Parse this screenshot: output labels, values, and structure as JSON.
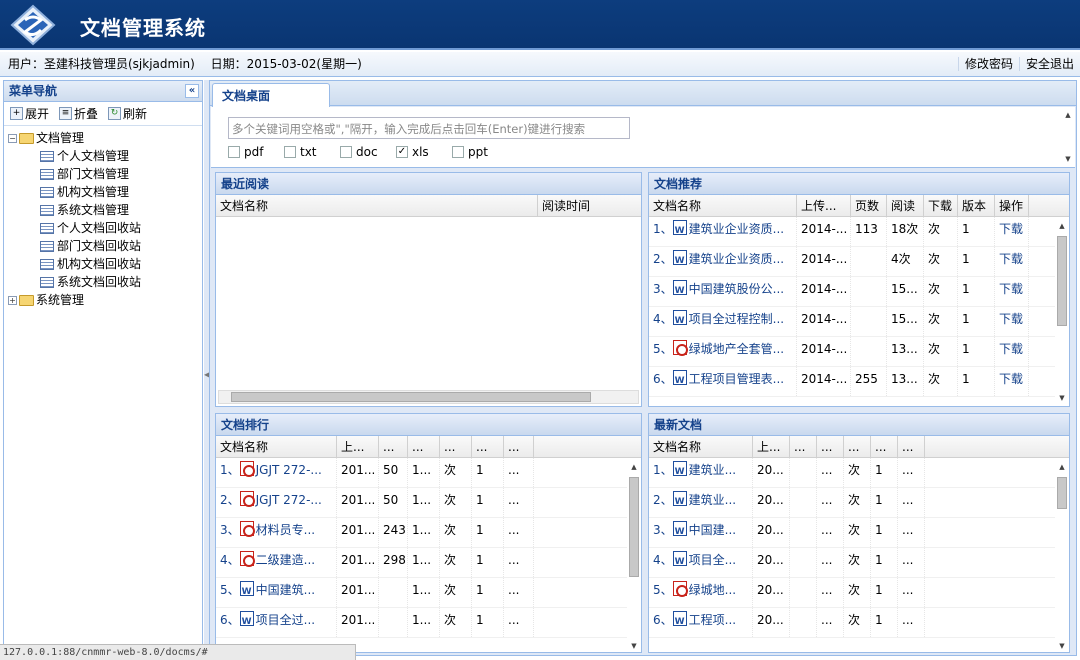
{
  "app": {
    "title": "文档管理系统"
  },
  "userbar": {
    "user_label": "用户：圣建科技管理员(sjkjadmin)",
    "date_label": "日期：2015-03-02(星期一)",
    "change_password": "修改密码",
    "logout": "安全退出"
  },
  "sidebar": {
    "title": "菜单导航",
    "expand": "展开",
    "fold": "折叠",
    "refresh": "刷新",
    "tree": [
      {
        "label": "文档管理",
        "expanded": true,
        "children": [
          "个人文档管理",
          "部门文档管理",
          "机构文档管理",
          "系统文档管理",
          "个人文档回收站",
          "部门文档回收站",
          "机构文档回收站",
          "系统文档回收站"
        ]
      },
      {
        "label": "系统管理",
        "expanded": false,
        "children": []
      }
    ]
  },
  "tabs": [
    {
      "label": "文档桌面",
      "active": true
    }
  ],
  "search": {
    "placeholder": "多个关键词用空格或\",\"隔开，输入完成后点击回车(Enter)键进行搜索",
    "types": [
      {
        "label": "pdf",
        "checked": false
      },
      {
        "label": "txt",
        "checked": false
      },
      {
        "label": "doc",
        "checked": false
      },
      {
        "label": "xls",
        "checked": true
      },
      {
        "label": "ppt",
        "checked": false
      }
    ]
  },
  "recent": {
    "title": "最近阅读",
    "columns": [
      "文档名称",
      "阅读时间"
    ],
    "rows": []
  },
  "recommend": {
    "title": "文档推荐",
    "columns": [
      "文档名称",
      "上传...",
      "页数",
      "阅读",
      "下载",
      "版本",
      "操作"
    ],
    "rows": [
      {
        "idx": "1、",
        "icon": "word",
        "name": "建筑业企业资质...",
        "date": "2014-...",
        "pages": "113",
        "reads": "18次",
        "downloads": "次",
        "version": "1",
        "action": "下载"
      },
      {
        "idx": "2、",
        "icon": "word",
        "name": "建筑业企业资质...",
        "date": "2014-...",
        "pages": "",
        "reads": "4次",
        "downloads": "次",
        "version": "1",
        "action": "下载"
      },
      {
        "idx": "3、",
        "icon": "word",
        "name": "中国建筑股份公...",
        "date": "2014-...",
        "pages": "",
        "reads": "15...",
        "downloads": "次",
        "version": "1",
        "action": "下载"
      },
      {
        "idx": "4、",
        "icon": "word",
        "name": "项目全过程控制...",
        "date": "2014-...",
        "pages": "",
        "reads": "15...",
        "downloads": "次",
        "version": "1",
        "action": "下载"
      },
      {
        "idx": "5、",
        "icon": "pdf",
        "name": "绿城地产全套管...",
        "date": "2014-...",
        "pages": "",
        "reads": "13...",
        "downloads": "次",
        "version": "1",
        "action": "下载"
      },
      {
        "idx": "6、",
        "icon": "word",
        "name": "工程项目管理表...",
        "date": "2014-...",
        "pages": "255",
        "reads": "13...",
        "downloads": "次",
        "version": "1",
        "action": "下载"
      }
    ]
  },
  "ranking": {
    "title": "文档排行",
    "columns": [
      "文档名称",
      "上...",
      "...",
      "...",
      "...",
      "...",
      "..."
    ],
    "rows": [
      {
        "idx": "1、",
        "icon": "pdf",
        "name": "JGJT 272-...",
        "date": "201...",
        "pages": "50",
        "reads": "1...",
        "downloads": "次",
        "version": "1",
        "action": "..."
      },
      {
        "idx": "2、",
        "icon": "pdf",
        "name": "JGJT 272-...",
        "date": "201...",
        "pages": "50",
        "reads": "1...",
        "downloads": "次",
        "version": "1",
        "action": "..."
      },
      {
        "idx": "3、",
        "icon": "pdf",
        "name": "材料员专...",
        "date": "201...",
        "pages": "243",
        "reads": "1...",
        "downloads": "次",
        "version": "1",
        "action": "..."
      },
      {
        "idx": "4、",
        "icon": "pdf",
        "name": "二级建造...",
        "date": "201...",
        "pages": "298",
        "reads": "1...",
        "downloads": "次",
        "version": "1",
        "action": "..."
      },
      {
        "idx": "5、",
        "icon": "word",
        "name": "中国建筑...",
        "date": "201...",
        "pages": "",
        "reads": "1...",
        "downloads": "次",
        "version": "1",
        "action": "..."
      },
      {
        "idx": "6、",
        "icon": "word",
        "name": "项目全过...",
        "date": "201...",
        "pages": "",
        "reads": "1...",
        "downloads": "次",
        "version": "1",
        "action": "..."
      }
    ]
  },
  "latest": {
    "title": "最新文档",
    "columns": [
      "文档名称",
      "上...",
      "...",
      "...",
      "...",
      "...",
      "..."
    ],
    "rows": [
      {
        "idx": "1、",
        "icon": "word",
        "name": "建筑业...",
        "date": "20...",
        "pages": "",
        "reads": "...",
        "downloads": "次",
        "version": "1",
        "action": "..."
      },
      {
        "idx": "2、",
        "icon": "word",
        "name": "建筑业...",
        "date": "20...",
        "pages": "",
        "reads": "...",
        "downloads": "次",
        "version": "1",
        "action": "..."
      },
      {
        "idx": "3、",
        "icon": "word",
        "name": "中国建...",
        "date": "20...",
        "pages": "",
        "reads": "...",
        "downloads": "次",
        "version": "1",
        "action": "..."
      },
      {
        "idx": "4、",
        "icon": "word",
        "name": "项目全...",
        "date": "20...",
        "pages": "",
        "reads": "...",
        "downloads": "次",
        "version": "1",
        "action": "..."
      },
      {
        "idx": "5、",
        "icon": "pdf",
        "name": "绿城地...",
        "date": "20...",
        "pages": "",
        "reads": "...",
        "downloads": "次",
        "version": "1",
        "action": "..."
      },
      {
        "idx": "6、",
        "icon": "word",
        "name": "工程项...",
        "date": "20...",
        "pages": "",
        "reads": "...",
        "downloads": "次",
        "version": "1",
        "action": "..."
      }
    ]
  },
  "status": {
    "url": "127.0.0.1:88/cnmmr-web-8.0/docms/#"
  }
}
